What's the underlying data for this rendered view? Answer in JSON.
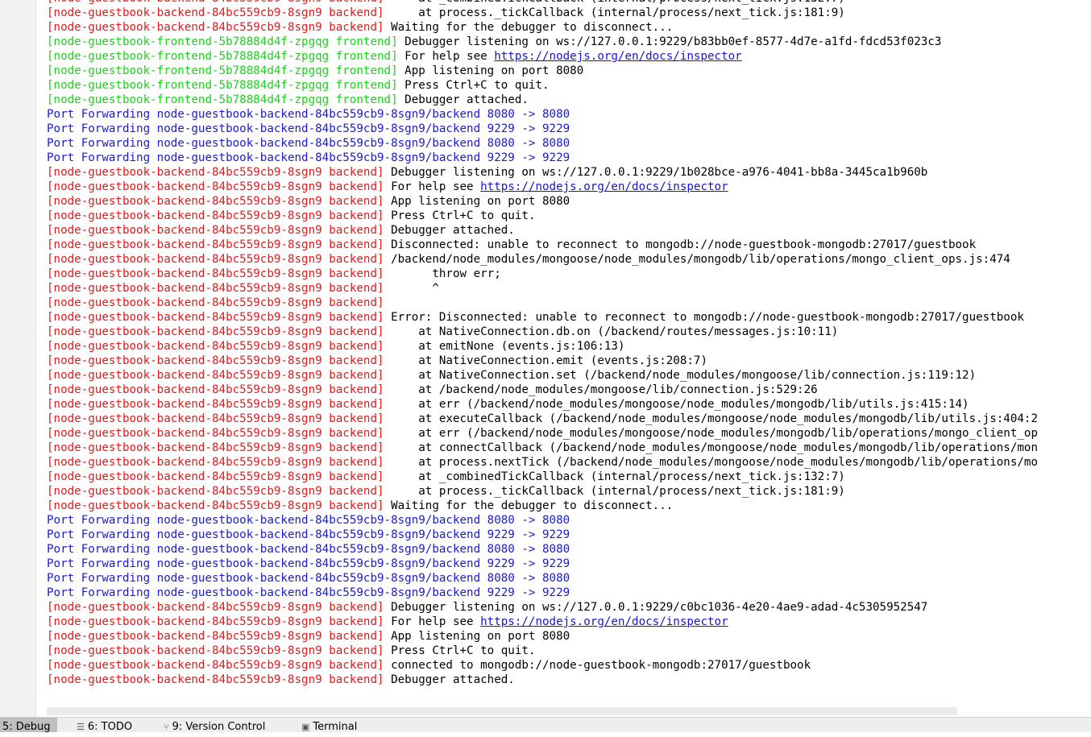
{
  "console": {
    "lines": [
      {
        "kind": "backend",
        "src": "[node-guestbook-backend-84bc559cb9-8sgn9 backend]",
        "text": "     at _combinedTickCallback (internal/process/next_tick.js:132:7)"
      },
      {
        "kind": "backend",
        "src": "[node-guestbook-backend-84bc559cb9-8sgn9 backend]",
        "text": "     at process._tickCallback (internal/process/next_tick.js:181:9)"
      },
      {
        "kind": "backend",
        "src": "[node-guestbook-backend-84bc559cb9-8sgn9 backend]",
        "text": " Waiting for the debugger to disconnect..."
      },
      {
        "kind": "frontend",
        "src": "[node-guestbook-frontend-5b78884d4f-zpgqg frontend]",
        "text": " Debugger listening on ws://127.0.0.1:9229/b83bb0ef-8577-4d7e-a1fd-fdcd53f023c3"
      },
      {
        "kind": "frontend",
        "src": "[node-guestbook-frontend-5b78884d4f-zpgqg frontend]",
        "text": " For help see ",
        "link": "https://nodejs.org/en/docs/inspector"
      },
      {
        "kind": "frontend",
        "src": "[node-guestbook-frontend-5b78884d4f-zpgqg frontend]",
        "text": " App listening on port 8080"
      },
      {
        "kind": "frontend",
        "src": "[node-guestbook-frontend-5b78884d4f-zpgqg frontend]",
        "text": " Press Ctrl+C to quit."
      },
      {
        "kind": "frontend",
        "src": "[node-guestbook-frontend-5b78884d4f-zpgqg frontend]",
        "text": " Debugger attached."
      },
      {
        "kind": "pf",
        "text": "Port Forwarding node-guestbook-backend-84bc559cb9-8sgn9/backend 8080 -> 8080"
      },
      {
        "kind": "pf",
        "text": "Port Forwarding node-guestbook-backend-84bc559cb9-8sgn9/backend 9229 -> 9229"
      },
      {
        "kind": "pf",
        "text": "Port Forwarding node-guestbook-backend-84bc559cb9-8sgn9/backend 8080 -> 8080"
      },
      {
        "kind": "pf",
        "text": "Port Forwarding node-guestbook-backend-84bc559cb9-8sgn9/backend 9229 -> 9229"
      },
      {
        "kind": "backend",
        "src": "[node-guestbook-backend-84bc559cb9-8sgn9 backend]",
        "text": " Debugger listening on ws://127.0.0.1:9229/1b028bce-a976-4041-bb8a-3445ca1b960b"
      },
      {
        "kind": "backend",
        "src": "[node-guestbook-backend-84bc559cb9-8sgn9 backend]",
        "text": " For help see ",
        "link": "https://nodejs.org/en/docs/inspector"
      },
      {
        "kind": "backend",
        "src": "[node-guestbook-backend-84bc559cb9-8sgn9 backend]",
        "text": " App listening on port 8080"
      },
      {
        "kind": "backend",
        "src": "[node-guestbook-backend-84bc559cb9-8sgn9 backend]",
        "text": " Press Ctrl+C to quit."
      },
      {
        "kind": "backend",
        "src": "[node-guestbook-backend-84bc559cb9-8sgn9 backend]",
        "text": " Debugger attached."
      },
      {
        "kind": "backend",
        "src": "[node-guestbook-backend-84bc559cb9-8sgn9 backend]",
        "text": " Disconnected: unable to reconnect to mongodb://node-guestbook-mongodb:27017/guestbook"
      },
      {
        "kind": "backend",
        "src": "[node-guestbook-backend-84bc559cb9-8sgn9 backend]",
        "text": " /backend/node_modules/mongoose/node_modules/mongodb/lib/operations/mongo_client_ops.js:474"
      },
      {
        "kind": "backend",
        "src": "[node-guestbook-backend-84bc559cb9-8sgn9 backend]",
        "text": "       throw err;"
      },
      {
        "kind": "backend",
        "src": "[node-guestbook-backend-84bc559cb9-8sgn9 backend]",
        "text": "       ^"
      },
      {
        "kind": "backend",
        "src": "[node-guestbook-backend-84bc559cb9-8sgn9 backend]",
        "text": ""
      },
      {
        "kind": "backend",
        "src": "[node-guestbook-backend-84bc559cb9-8sgn9 backend]",
        "text": " Error: Disconnected: unable to reconnect to mongodb://node-guestbook-mongodb:27017/guestbook"
      },
      {
        "kind": "backend",
        "src": "[node-guestbook-backend-84bc559cb9-8sgn9 backend]",
        "text": "     at NativeConnection.db.on (/backend/routes/messages.js:10:11)"
      },
      {
        "kind": "backend",
        "src": "[node-guestbook-backend-84bc559cb9-8sgn9 backend]",
        "text": "     at emitNone (events.js:106:13)"
      },
      {
        "kind": "backend",
        "src": "[node-guestbook-backend-84bc559cb9-8sgn9 backend]",
        "text": "     at NativeConnection.emit (events.js:208:7)"
      },
      {
        "kind": "backend",
        "src": "[node-guestbook-backend-84bc559cb9-8sgn9 backend]",
        "text": "     at NativeConnection.set (/backend/node_modules/mongoose/lib/connection.js:119:12)"
      },
      {
        "kind": "backend",
        "src": "[node-guestbook-backend-84bc559cb9-8sgn9 backend]",
        "text": "     at /backend/node_modules/mongoose/lib/connection.js:529:26"
      },
      {
        "kind": "backend",
        "src": "[node-guestbook-backend-84bc559cb9-8sgn9 backend]",
        "text": "     at err (/backend/node_modules/mongoose/node_modules/mongodb/lib/utils.js:415:14)"
      },
      {
        "kind": "backend",
        "src": "[node-guestbook-backend-84bc559cb9-8sgn9 backend]",
        "text": "     at executeCallback (/backend/node_modules/mongoose/node_modules/mongodb/lib/utils.js:404:2"
      },
      {
        "kind": "backend",
        "src": "[node-guestbook-backend-84bc559cb9-8sgn9 backend]",
        "text": "     at err (/backend/node_modules/mongoose/node_modules/mongodb/lib/operations/mongo_client_op"
      },
      {
        "kind": "backend",
        "src": "[node-guestbook-backend-84bc559cb9-8sgn9 backend]",
        "text": "     at connectCallback (/backend/node_modules/mongoose/node_modules/mongodb/lib/operations/mon"
      },
      {
        "kind": "backend",
        "src": "[node-guestbook-backend-84bc559cb9-8sgn9 backend]",
        "text": "     at process.nextTick (/backend/node_modules/mongoose/node_modules/mongodb/lib/operations/mo"
      },
      {
        "kind": "backend",
        "src": "[node-guestbook-backend-84bc559cb9-8sgn9 backend]",
        "text": "     at _combinedTickCallback (internal/process/next_tick.js:132:7)"
      },
      {
        "kind": "backend",
        "src": "[node-guestbook-backend-84bc559cb9-8sgn9 backend]",
        "text": "     at process._tickCallback (internal/process/next_tick.js:181:9)"
      },
      {
        "kind": "backend",
        "src": "[node-guestbook-backend-84bc559cb9-8sgn9 backend]",
        "text": " Waiting for the debugger to disconnect..."
      },
      {
        "kind": "pf",
        "text": "Port Forwarding node-guestbook-backend-84bc559cb9-8sgn9/backend 8080 -> 8080"
      },
      {
        "kind": "pf",
        "text": "Port Forwarding node-guestbook-backend-84bc559cb9-8sgn9/backend 9229 -> 9229"
      },
      {
        "kind": "pf",
        "text": "Port Forwarding node-guestbook-backend-84bc559cb9-8sgn9/backend 8080 -> 8080"
      },
      {
        "kind": "pf",
        "text": "Port Forwarding node-guestbook-backend-84bc559cb9-8sgn9/backend 9229 -> 9229"
      },
      {
        "kind": "pf",
        "text": "Port Forwarding node-guestbook-backend-84bc559cb9-8sgn9/backend 8080 -> 8080"
      },
      {
        "kind": "pf",
        "text": "Port Forwarding node-guestbook-backend-84bc559cb9-8sgn9/backend 9229 -> 9229"
      },
      {
        "kind": "backend",
        "src": "[node-guestbook-backend-84bc559cb9-8sgn9 backend]",
        "text": " Debugger listening on ws://127.0.0.1:9229/c0bc1036-4e20-4ae9-adad-4c5305952547"
      },
      {
        "kind": "backend",
        "src": "[node-guestbook-backend-84bc559cb9-8sgn9 backend]",
        "text": " For help see ",
        "link": "https://nodejs.org/en/docs/inspector"
      },
      {
        "kind": "backend",
        "src": "[node-guestbook-backend-84bc559cb9-8sgn9 backend]",
        "text": " App listening on port 8080"
      },
      {
        "kind": "backend",
        "src": "[node-guestbook-backend-84bc559cb9-8sgn9 backend]",
        "text": " Press Ctrl+C to quit."
      },
      {
        "kind": "backend",
        "src": "[node-guestbook-backend-84bc559cb9-8sgn9 backend]",
        "text": " connected to mongodb://node-guestbook-mongodb:27017/guestbook"
      },
      {
        "kind": "backend",
        "src": "[node-guestbook-backend-84bc559cb9-8sgn9 backend]",
        "text": " Debugger attached."
      }
    ]
  },
  "statusbar": {
    "tabs": [
      {
        "label": "5: Debug",
        "icon": "debug-icon",
        "active": true
      },
      {
        "label": "6: TODO",
        "icon": "list-icon",
        "active": false
      },
      {
        "label": "9: Version Control",
        "icon": "branch-icon",
        "active": false
      },
      {
        "label": "Terminal",
        "icon": "terminal-icon",
        "active": false
      }
    ]
  },
  "colors": {
    "frontend_source": "#1fd01f",
    "backend_source": "#e21a1a",
    "port_forwarding": "#1a1ad0",
    "link": "#1515d4"
  }
}
